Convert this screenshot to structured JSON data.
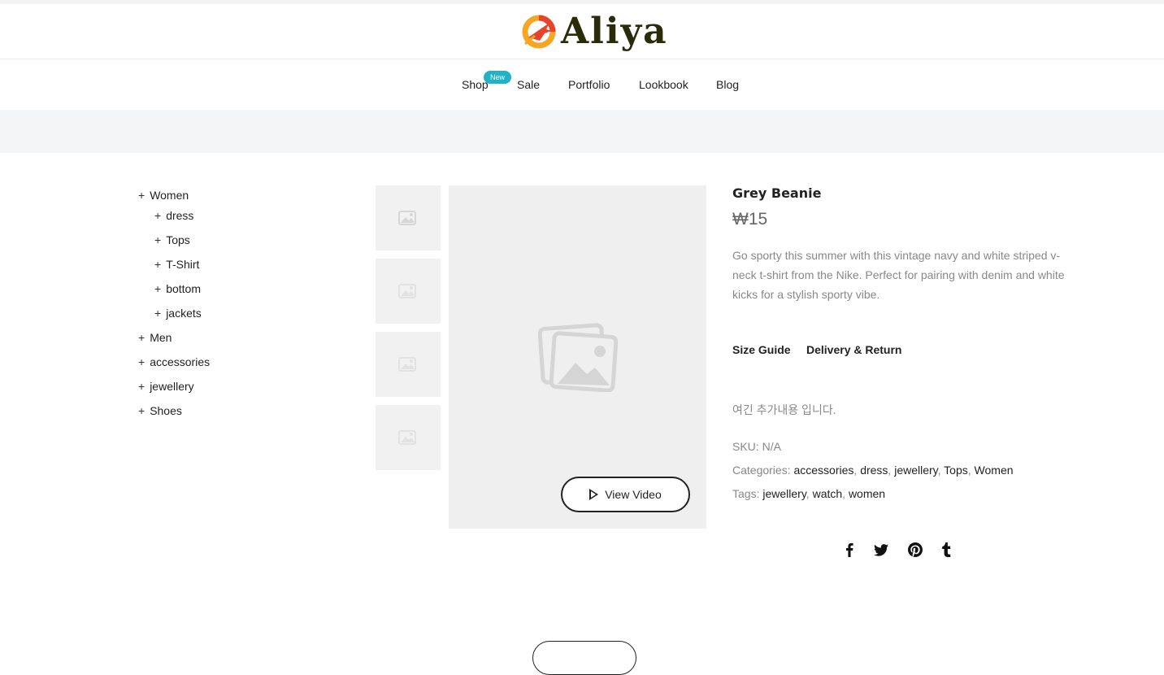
{
  "brand": {
    "name": "Aliya",
    "colors": {
      "orange": "#f5a623",
      "red": "#e8412c",
      "dark": "#2a2b08",
      "badge": "#1fb2c8"
    }
  },
  "nav": {
    "items": [
      {
        "label": "Shop"
      },
      {
        "label": "Sale"
      },
      {
        "label": "Portfolio"
      },
      {
        "label": "Lookbook"
      },
      {
        "label": "Blog"
      }
    ],
    "badge": "New"
  },
  "sidebar": {
    "categories": [
      {
        "label": "Women",
        "children": [
          "dress",
          "Tops",
          "T-Shirt",
          "bottom",
          "jackets"
        ]
      },
      {
        "label": "Men"
      },
      {
        "label": "accessories"
      },
      {
        "label": "jewellery"
      },
      {
        "label": "Shoes"
      }
    ],
    "expand_symbol": "+"
  },
  "gallery": {
    "thumbnail_count": 4,
    "video_button_label": "View Video",
    "icons": {
      "placeholder": "image-placeholder-icon",
      "play": "play-icon"
    }
  },
  "product": {
    "title": "Grey Beanie",
    "price": "₩15",
    "description": "Go sporty this summer with this vintage navy and white striped v-neck t-shirt from the Nike. Perfect for pairing with denim and white kicks for a stylish sporty vibe.",
    "tabs": [
      "Size Guide",
      "Delivery & Return"
    ],
    "extra_content": "여긴 추가내용 입니다.",
    "sku_label": "SKU:",
    "sku_value": "N/A",
    "categories_label": "Categories:",
    "categories": [
      "accessories",
      "dress",
      "jewellery",
      "Tops",
      "Women"
    ],
    "tags_label": "Tags:",
    "tags": [
      "jewellery",
      "watch",
      "women"
    ]
  },
  "social": [
    "facebook-icon",
    "twitter-icon",
    "pinterest-icon",
    "tumblr-icon"
  ]
}
